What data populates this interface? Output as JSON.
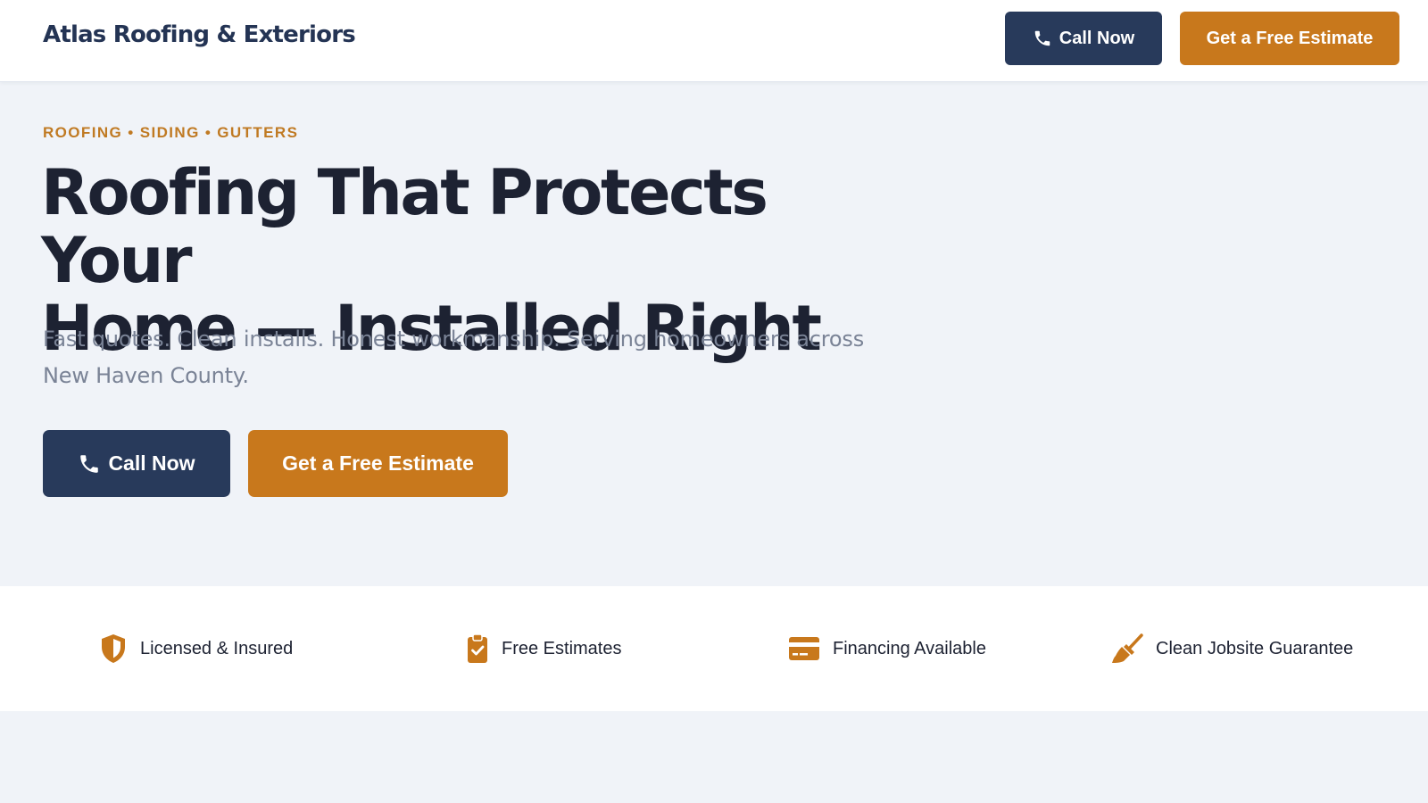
{
  "header": {
    "brand": "Atlas Roofing & Exteriors",
    "call_label": "Call Now",
    "estimate_label": "Get a Free Estimate"
  },
  "hero": {
    "eyebrow": "ROOFING • SIDING • GUTTERS",
    "headline_line1": "Roofing That Protects Your",
    "headline_line2": "Home — Installed Right",
    "subtext": "Fast quotes. Clean installs. Honest workmanship. Serving homeowners across New Haven County.",
    "call_label": "Call Now",
    "estimate_label": "Get a Free Estimate"
  },
  "trust": {
    "items": [
      {
        "label": "Licensed & Insured",
        "icon": "shield-icon"
      },
      {
        "label": "Free Estimates",
        "icon": "clipboard-check-icon"
      },
      {
        "label": "Financing Available",
        "icon": "credit-card-icon"
      },
      {
        "label": "Clean Jobsite Guarantee",
        "icon": "broom-icon"
      }
    ]
  },
  "colors": {
    "navy": "#283a5b",
    "orange": "#c8781c",
    "page_bg": "#f0f3f8"
  }
}
